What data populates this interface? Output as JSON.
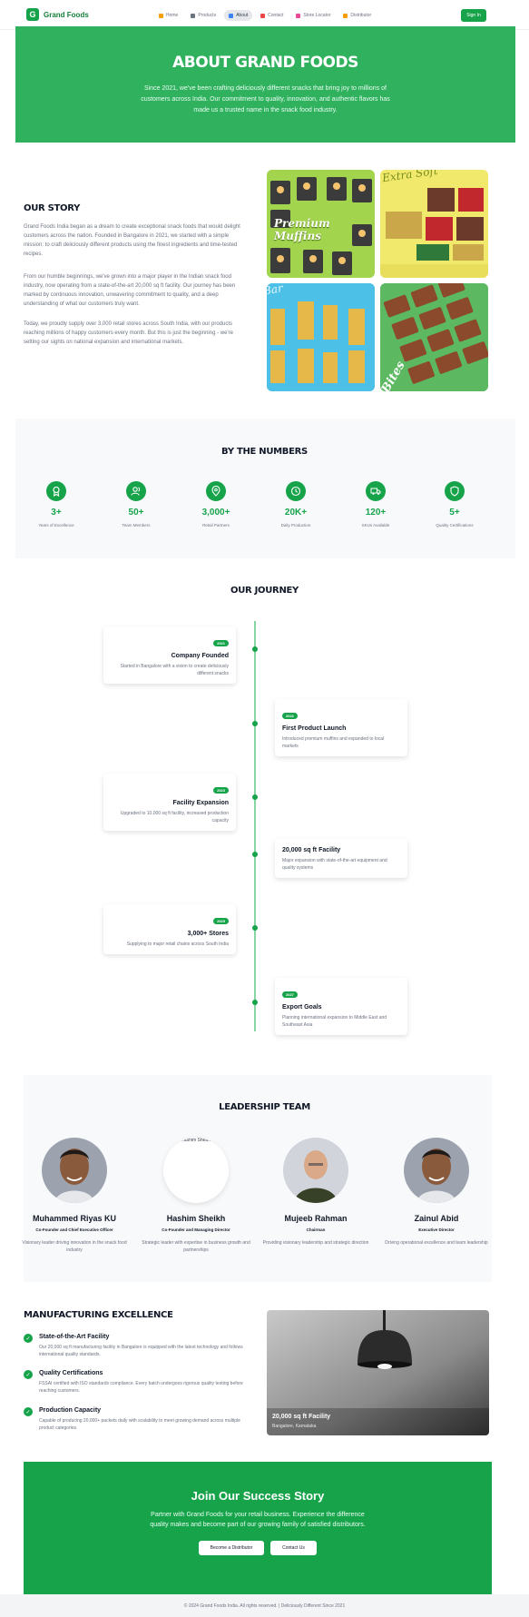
{
  "brand": {
    "logo_letter": "G",
    "name": "Grand Foods"
  },
  "nav": {
    "items": [
      {
        "label": "Home",
        "icon": "home-icon"
      },
      {
        "label": "Products",
        "icon": "box-icon"
      },
      {
        "label": "About",
        "icon": "info-icon"
      },
      {
        "label": "Contact",
        "icon": "phone-icon"
      },
      {
        "label": "Store Locator",
        "icon": "map-pin-icon"
      },
      {
        "label": "Distributor",
        "icon": "truck-icon"
      }
    ],
    "signin": "Sign In"
  },
  "hero": {
    "title": "ABOUT GRAND FOODS",
    "text": "Since 2021, we've been crafting deliciously different snacks that bring joy to millions of customers across India. Our commitment to quality, innovation, and authentic flavors has made us a trusted name in the snack food industry."
  },
  "story": {
    "title": "OUR STORY",
    "p1": "Grand Foods India began as a dream to create exceptional snack foods that would delight customers across the nation. Founded in Bangalore in 2021, we started with a simple mission: to craft deliciously different products using the finest ingredients and time-tested recipes.",
    "p2": "From our humble beginnings, we've grown into a major player in the Indian snack food industry, now operating from a state-of-the-art 20,000 sq ft facility. Our journey has been marked by continuous innovation, unwavering commitment to quality, and a deep understanding of what our customers truly want.",
    "p3": "Today, we proudly supply over 3,000 retail stores across South India, with our products reaching millions of happy customers every month. But this is just the beginning - we're setting our sights on national expansion and international markets.",
    "photos": {
      "muffins_label": "Premium Muffins",
      "extra_soft_label": "Extra Soft",
      "bar_label": "Bar",
      "bites_label": "Bites"
    }
  },
  "numbers": {
    "title": "BY THE NUMBERS",
    "stats": [
      {
        "value": "3+",
        "label": "Years of Excellence",
        "icon": "award-icon"
      },
      {
        "value": "50+",
        "label": "Team Members",
        "icon": "users-icon"
      },
      {
        "value": "3,000+",
        "label": "Retail Partners",
        "icon": "map-pin-icon"
      },
      {
        "value": "20K+",
        "label": "Daily Production",
        "icon": "clock-icon"
      },
      {
        "value": "120+",
        "label": "SKUs Available",
        "icon": "truck-icon"
      },
      {
        "value": "5+",
        "label": "Quality Certifications",
        "icon": "shield-icon"
      }
    ]
  },
  "journey": {
    "title": "OUR JOURNEY",
    "events": [
      {
        "year": "2021",
        "title": "Company Founded",
        "desc": "Started in Bangalore with a vision to create deliciously different snacks"
      },
      {
        "year": "2022",
        "title": "First Product Launch",
        "desc": "Introduced premium muffins and expanded to local markets"
      },
      {
        "year": "2023",
        "title": "Facility Expansion",
        "desc": "Upgraded to 10,000 sq ft facility, increased production capacity"
      },
      {
        "year": "",
        "title": "20,000 sq ft Facility",
        "desc": "Major expansion with state-of-the-art equipment and quality systems"
      },
      {
        "year": "2025",
        "title": "3,000+ Stores",
        "desc": "Supplying to major retail chains across South India"
      },
      {
        "year": "2027",
        "title": "Export Goals",
        "desc": "Planning international expansion to Middle East and Southeast Asia"
      }
    ]
  },
  "leadership": {
    "title": "LEADERSHIP TEAM",
    "members": [
      {
        "name": "Muhammed Riyas KU",
        "role": "Co-Founder and Chief Executive Officer",
        "desc": "Visionary leader driving innovation in the snack food industry"
      },
      {
        "name": "Hashim Sheikh",
        "role": "Co-Founder and Managing Director",
        "desc": "Strategic leader with expertise in business growth and partnerships",
        "alt_text": "..ashim Shea.."
      },
      {
        "name": "Mujeeb Rahman",
        "role": "Chairman",
        "desc": "Providing visionary leadership and strategic direction"
      },
      {
        "name": "Zainul Abid",
        "role": "Executive Director",
        "desc": "Driving operational excellence and team leadership"
      }
    ]
  },
  "manufacturing": {
    "title": "MANUFACTURING EXCELLENCE",
    "items": [
      {
        "title": "State-of-the-Art Facility",
        "desc": "Our 20,000 sq ft manufacturing facility in Bangalore is equipped with the latest technology and follows international quality standards."
      },
      {
        "title": "Quality Certifications",
        "desc": "FSSAI certified with ISO standards compliance. Every batch undergoes rigorous quality testing before reaching customers."
      },
      {
        "title": "Production Capacity",
        "desc": "Capable of producing 20,000+ packets daily with scalability to meet growing demand across multiple product categories."
      }
    ],
    "image_caption": "20,000 sq ft Facility",
    "image_sub": "Bangalore, Karnataka"
  },
  "cta": {
    "title": "Join Our Success Story",
    "text": "Partner with Grand Foods for your retail business. Experience the difference quality makes and become part of our growing family of satisfied distributors.",
    "btn_primary": "Become a Distributor",
    "btn_secondary": "Contact Us"
  },
  "footer": {
    "text": "© 2024 Grand Foods India. All rights reserved. | Deliciously Different Since 2021"
  },
  "colors": {
    "brand_green": "#16a34a",
    "hero_green": "#2fb15d",
    "timeline_line": "#86d6a4"
  }
}
